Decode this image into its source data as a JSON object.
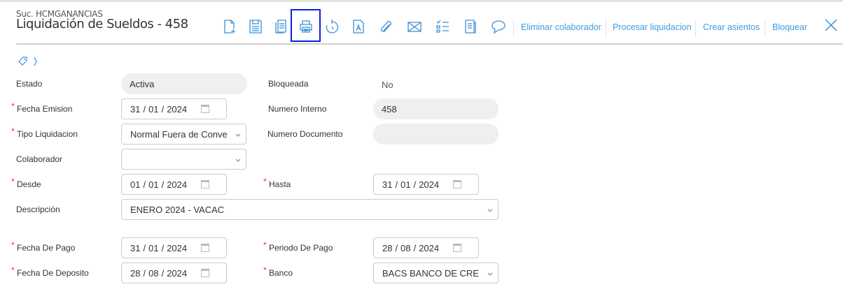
{
  "header": {
    "branch": "Suc. HCMGANANCIAS",
    "title": "Liquidación de Sueldos - 458"
  },
  "toolbar": {
    "icons": [
      "new-document",
      "save",
      "copy",
      "print",
      "history",
      "report",
      "attachment",
      "email",
      "checklist",
      "document",
      "comment"
    ],
    "actions": [
      "Eliminar colaborador",
      "Procesar liquidacion",
      "Crear asientos",
      "Bloquear"
    ]
  },
  "form": {
    "estado": {
      "label": "Estado",
      "value": "Activa"
    },
    "bloqueada": {
      "label": "Bloqueada",
      "value": "No"
    },
    "fecha_emision": {
      "label": "Fecha Emision",
      "d": "31",
      "m": "01",
      "y": "2024"
    },
    "numero_interno": {
      "label": "Numero Interno",
      "value": "458"
    },
    "tipo_liquidacion": {
      "label": "Tipo Liquidacion",
      "value": "Normal Fuera de Conve"
    },
    "numero_documento": {
      "label": "Numero Documento",
      "value": ""
    },
    "colaborador": {
      "label": "Colaborador",
      "value": ""
    },
    "desde": {
      "label": "Desde",
      "d": "01",
      "m": "01",
      "y": "2024"
    },
    "hasta": {
      "label": "Hasta",
      "d": "31",
      "m": "01",
      "y": "2024"
    },
    "descripcion": {
      "label": "Descripción",
      "value": "ENERO 2024 - VACAC"
    },
    "fecha_pago": {
      "label": "Fecha De Pago",
      "d": "31",
      "m": "01",
      "y": "2024"
    },
    "periodo_pago": {
      "label": "Periodo De Pago",
      "d": "28",
      "m": "08",
      "y": "2024"
    },
    "fecha_deposito": {
      "label": "Fecha De Deposito",
      "d": "28",
      "m": "08",
      "y": "2024"
    },
    "banco": {
      "label": "Banco",
      "value": "BACS BANCO DE CRE"
    }
  },
  "required_mark": "*"
}
